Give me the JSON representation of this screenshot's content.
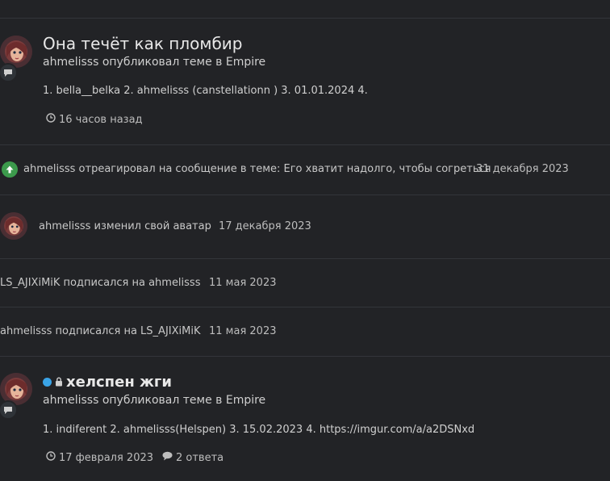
{
  "posts": [
    {
      "title": "Она течёт как пломбир",
      "subtitle": "ahmelisss опубликовал теме в Empire",
      "body": "1. bella__belka 2. ahmelisss (canstellationn ) 3. 01.01.2024 4.",
      "time": "16 часов назад"
    },
    {
      "title": "хелспен жги",
      "subtitle": "ahmelisss опубликовал теме в Empire",
      "body": "1. indiferent 2. ahmelisss(Helspen) 3. 15.02.2023 4. https://imgur.com/a/a2DSNxd",
      "time": "17 февраля 2023",
      "replies": "2 ответа"
    }
  ],
  "activities": [
    {
      "text": "ahmelisss отреагировал на сообщение в теме: Его хватит надолго, чтобы согреться",
      "date": "31 декабря 2023"
    },
    {
      "text": "ahmelisss изменил свой аватар",
      "date": "17 декабря 2023"
    },
    {
      "text": "LS_AJIXiMiK подписался на ahmelisss",
      "date": "11 мая 2023"
    },
    {
      "text": "ahmelisss подписался на LS_AJIXiMiK",
      "date": "11 мая 2023"
    }
  ],
  "icons": {
    "chat": "chat-bubble-icon",
    "clock": "clock-icon",
    "reaction": "arrow-up-icon",
    "lock": "lock-icon",
    "online": "online-dot-icon",
    "comment": "comment-icon"
  },
  "colors": {
    "background": "#222326",
    "divider": "#33353a",
    "reaction_green": "#3c9a4c",
    "online_blue": "#3aa3e6"
  }
}
